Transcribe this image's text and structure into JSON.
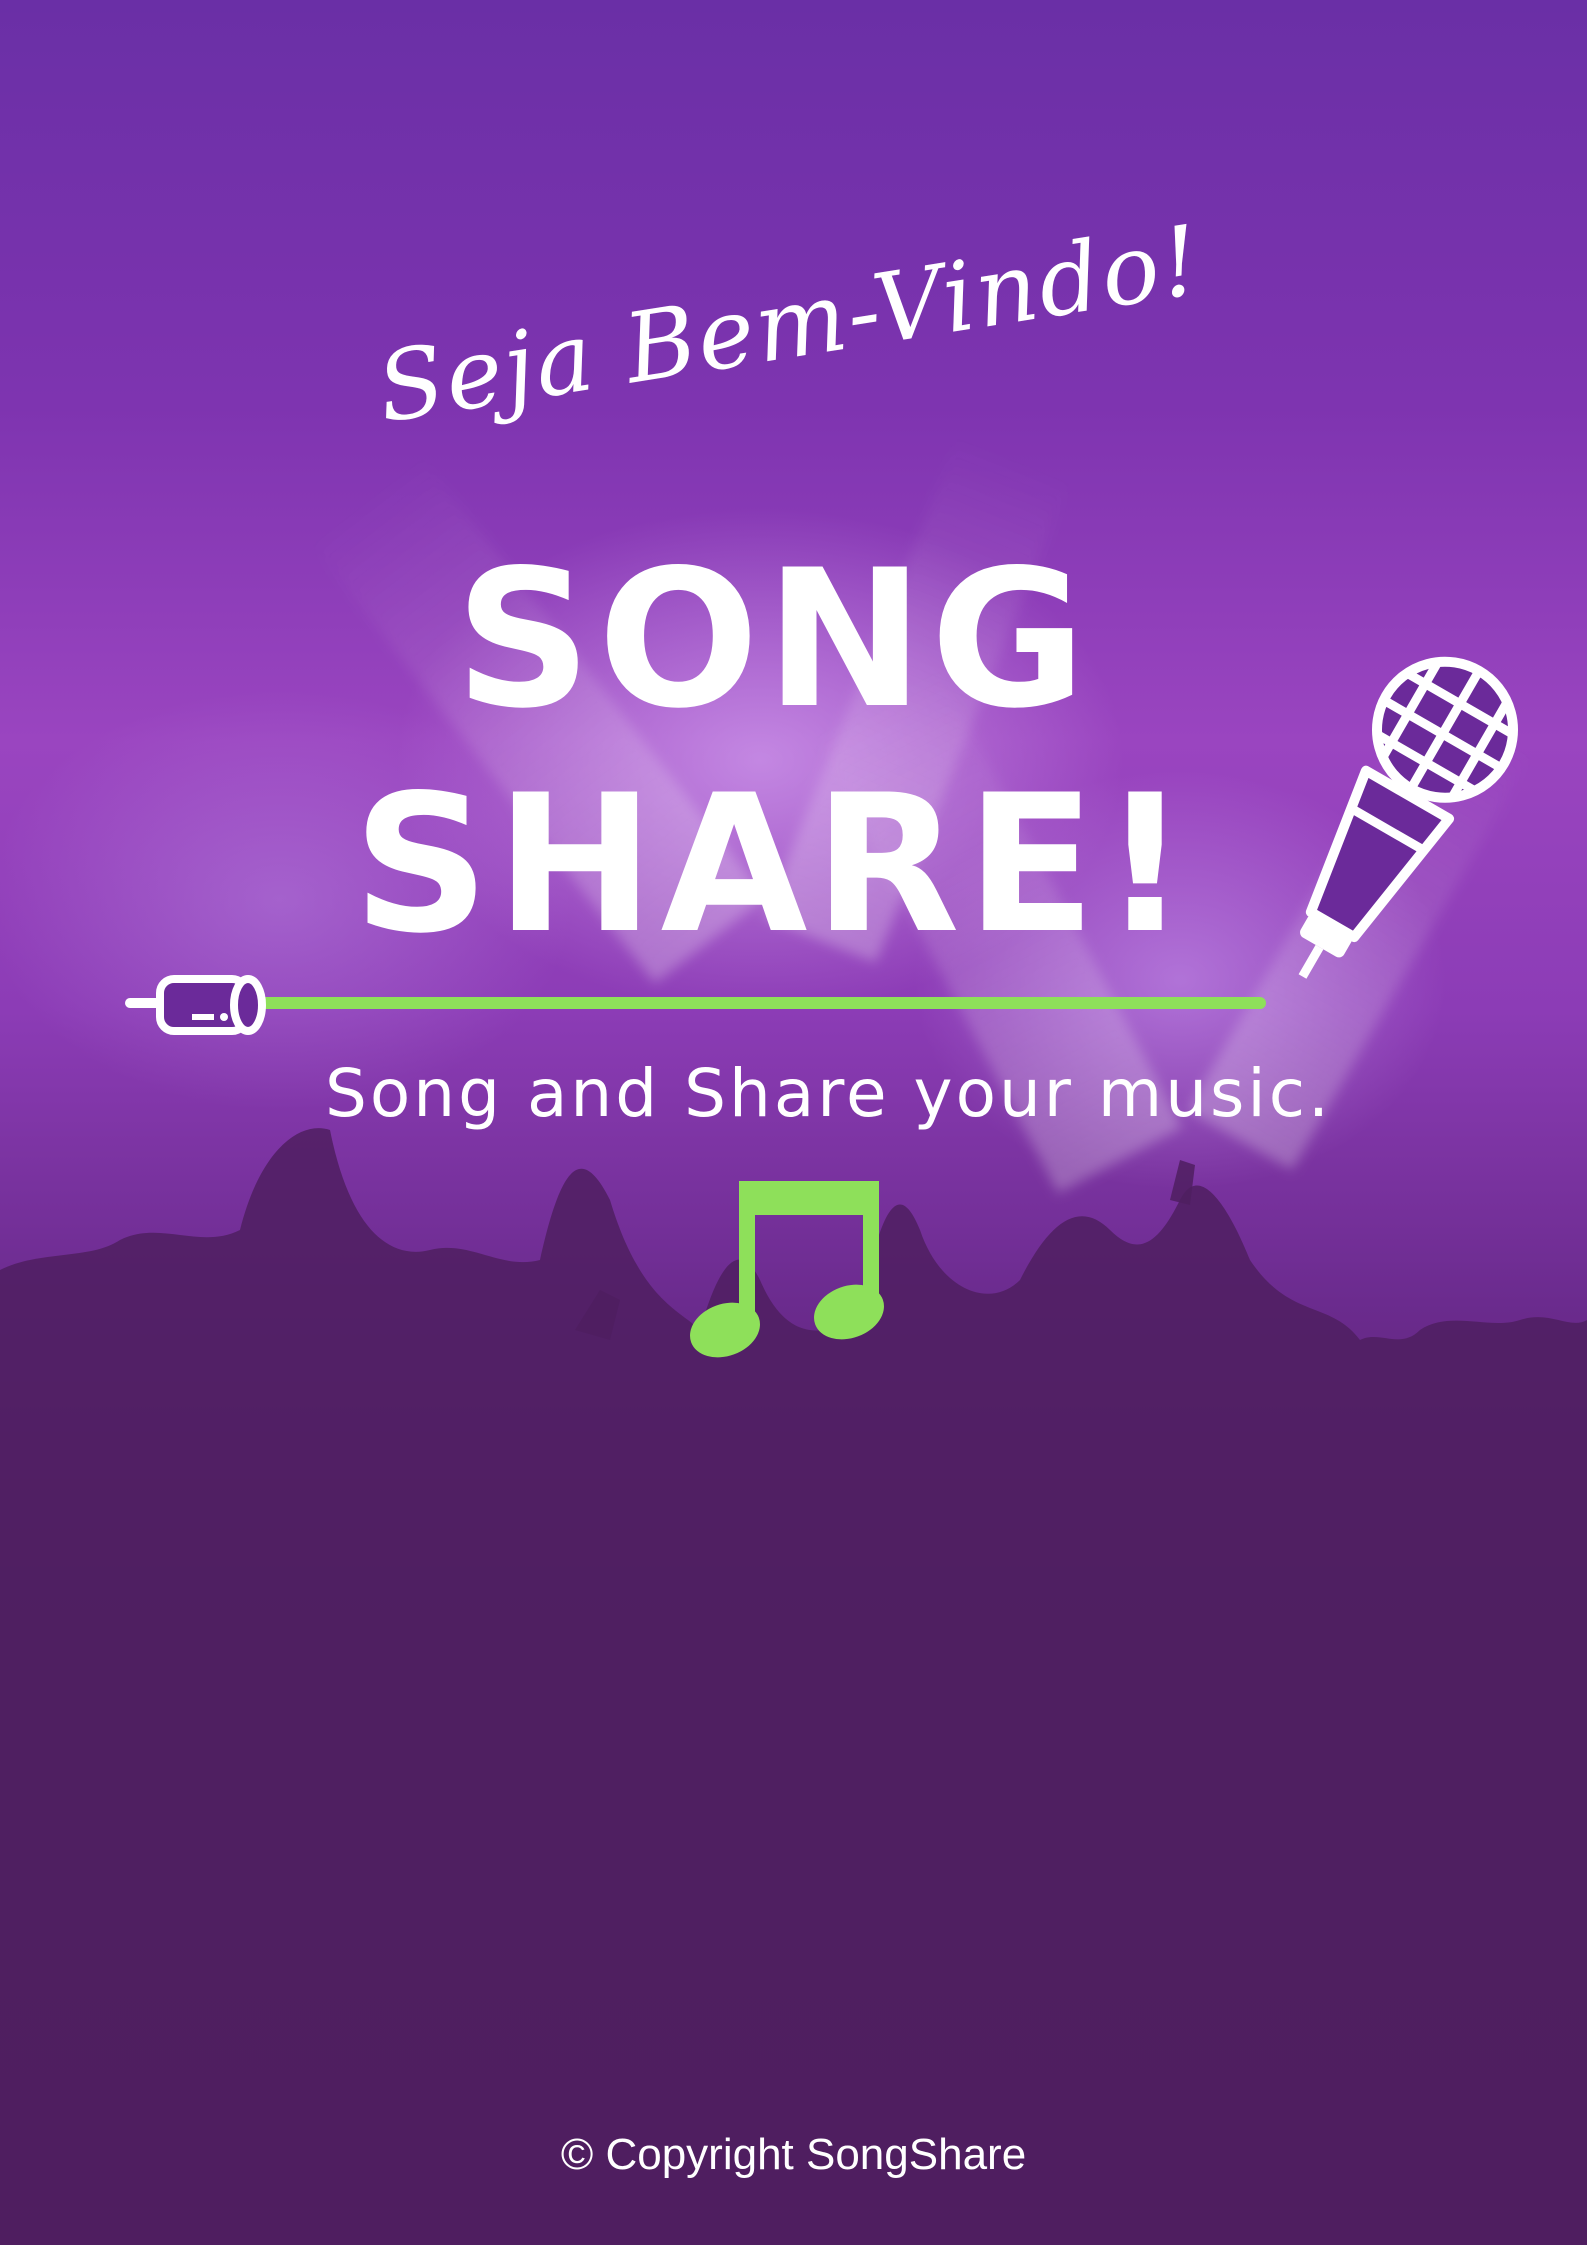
{
  "poster": {
    "welcome_text": "Seja Bem-Vindo!",
    "title_line_1": "SONG",
    "title_line_2": "SHARE!",
    "tagline": "Song and Share your music.",
    "copyright": "© Copyright SongShare"
  },
  "icons": {
    "microphone": "microphone-icon",
    "cable": "audio-cable-icon",
    "music_note": "music-note-icon"
  },
  "colors": {
    "accent_green": "#8ee05a",
    "icon_purple": "#6b2a9a",
    "text": "#ffffff",
    "background_bottom": "#4f205d"
  }
}
